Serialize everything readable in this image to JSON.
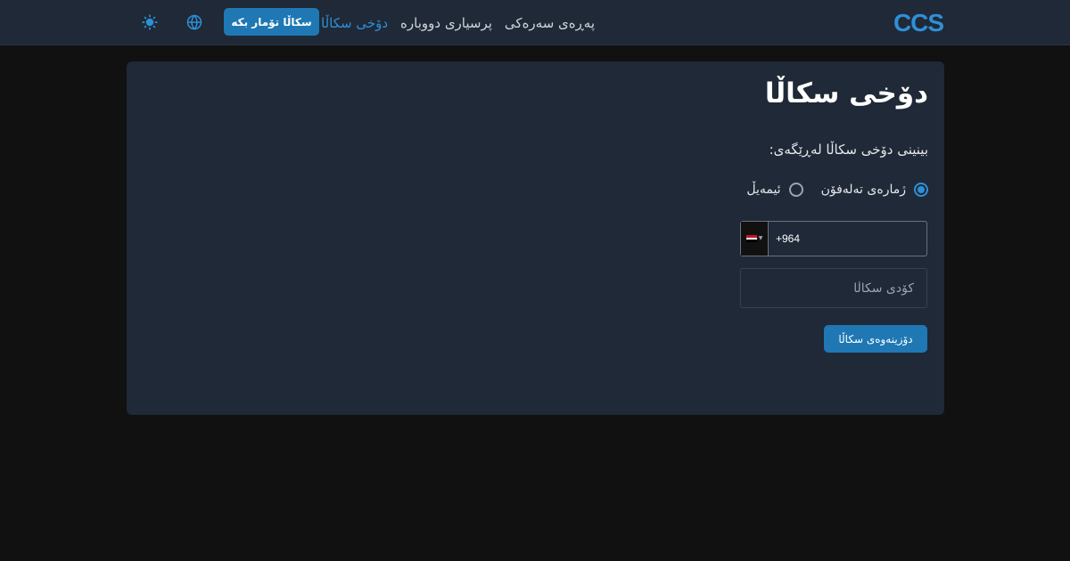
{
  "header": {
    "logo_text": "CCS",
    "nav": [
      {
        "label": "پەڕەی سەرەکی",
        "active": false
      },
      {
        "label": "پرسیاری دووبارە",
        "active": false
      },
      {
        "label": "دۆخی سکاڵا",
        "active": true
      }
    ],
    "register_label": "سکاڵا تۆمار بکە",
    "icons": [
      "globe-icon",
      "sun-icon"
    ]
  },
  "main": {
    "title": "دۆخی سکاڵا",
    "subtitle": "بینینی دۆخی سکاڵا لەڕێگەی:",
    "options": [
      {
        "label": "ژمارەی تەلەفۆن",
        "checked": true
      },
      {
        "label": "ئیمەیڵ",
        "checked": false
      }
    ],
    "phone": {
      "country_flag": "iraq-flag-icon",
      "value": "+964"
    },
    "code_placeholder": "کۆدی سکاڵا",
    "search_label": "دۆزینەوەی سکاڵا"
  },
  "colors": {
    "accent": "#1f78b4",
    "accent_text": "#2f8fd6",
    "navbar_bg": "#1f2937",
    "card_bg": "#1f2937",
    "page_bg": "#111111"
  }
}
